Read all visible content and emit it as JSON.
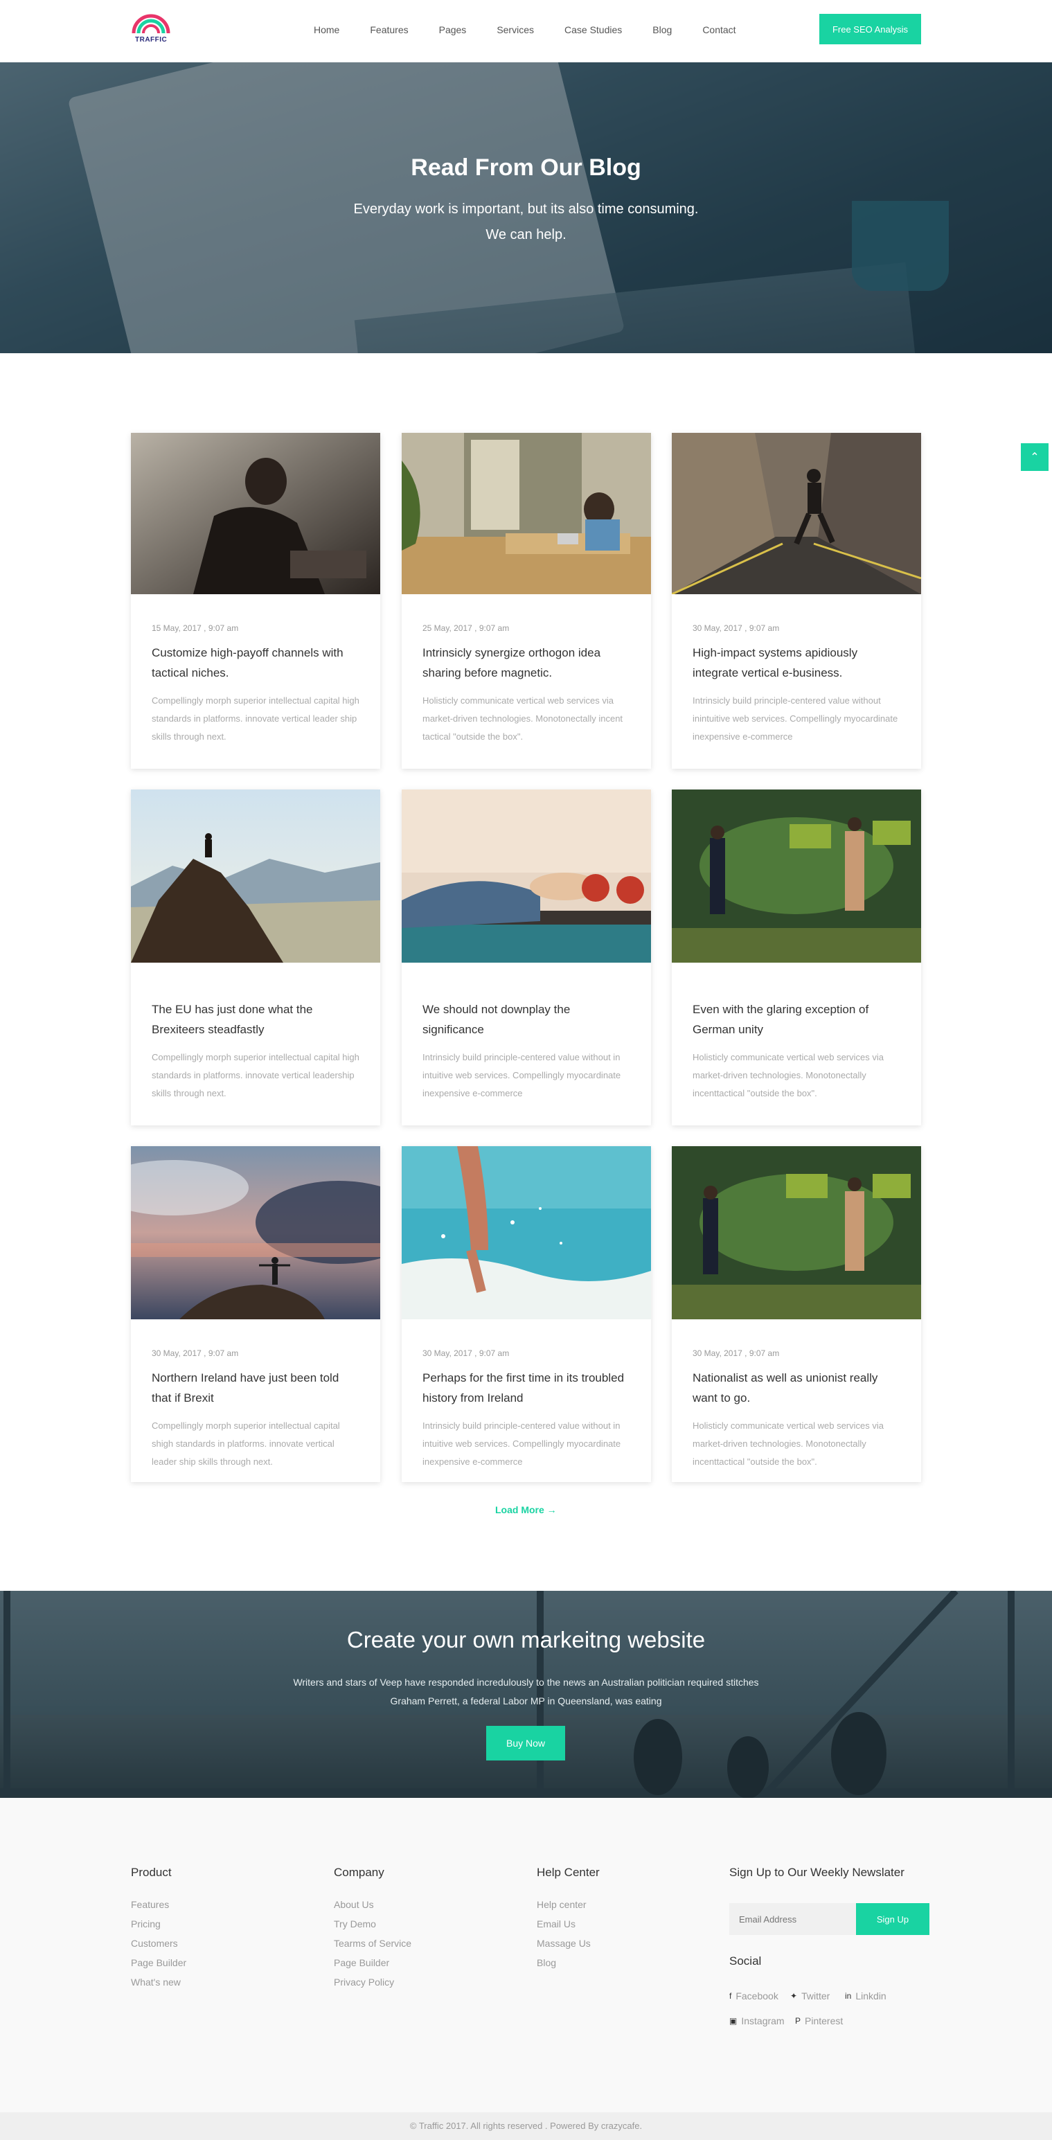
{
  "brand": {
    "logo_text": "TRAFFIC",
    "accent": "#19d3a2"
  },
  "nav": {
    "items": [
      "Home",
      "Features",
      "Pages",
      "Services",
      "Case Studies",
      "Blog",
      "Contact"
    ],
    "cta": "Free SEO Analysis"
  },
  "hero": {
    "title": "Read From Our Blog",
    "line1": "Everyday work is important, but its also time consuming.",
    "line2": "We can help."
  },
  "posts": [
    {
      "date": "15 May, 2017 , 9:07 am",
      "title": "Customize high-payoff channels with tactical niches.",
      "excerpt": "Compellingly morph superior intellectual capital high standards in platforms. innovate vertical leader ship skills through next."
    },
    {
      "date": "25 May, 2017 , 9:07 am",
      "title": "Intrinsicly synergize orthogon idea sharing before magnetic.",
      "excerpt": "Holisticly communicate vertical web services via market-driven technologies. Monotonectally incent tactical \"outside the box\"."
    },
    {
      "date": "30 May, 2017 , 9:07 am",
      "title": "High-impact systems apidiously integrate vertical e-business.",
      "excerpt": "Intrinsicly build principle-centered value without inintuitive web services. Compellingly myocardinate inexpensive e-commerce"
    },
    {
      "date": "",
      "title": "The EU has just done what the Brexiteers steadfastly",
      "excerpt": "Compellingly morph superior intellectual capital high standards in platforms. innovate vertical leadership skills through next."
    },
    {
      "date": "",
      "title": "We should not downplay the significance",
      "excerpt": "Intrinsicly build principle-centered value without in intuitive web services. Compellingly myocardinate inexpensive e-commerce"
    },
    {
      "date": "",
      "title": "Even with the glaring exception of German unity",
      "excerpt": "Holisticly communicate vertical web services via market-driven technologies. Monotonectally incenttactical \"outside the box\"."
    },
    {
      "date": "30 May, 2017 , 9:07 am",
      "title": "Northern Ireland have just been told that if Brexit",
      "excerpt": "Compellingly morph superior intellectual capital shigh standards in platforms. innovate vertical leader ship skills through next."
    },
    {
      "date": "30 May, 2017 , 9:07 am",
      "title": "Perhaps for the first time in its troubled history from Ireland",
      "excerpt": "Intrinsicly build principle-centered value without in intuitive web services. Compellingly myocardinate inexpensive e-commerce"
    },
    {
      "date": "30 May, 2017 , 9:07 am",
      "title": "Nationalist as well as unionist really want to go.",
      "excerpt": "Holisticly communicate vertical web services via market-driven technologies. Monotonectally incenttactical \"outside the box\"."
    }
  ],
  "load_more": "Load More",
  "cta": {
    "title": "Create your own markeitng website",
    "line1": "Writers and stars of Veep have responded incredulously to the news an Australian politician required stitches",
    "line2": "Graham Perrett, a federal Labor MP in Queensland, was eating",
    "button": "Buy Now"
  },
  "footer": {
    "product": {
      "title": "Product",
      "links": [
        "Features",
        "Pricing",
        "Customers",
        "Page Builder",
        "What's new"
      ]
    },
    "company": {
      "title": "Company",
      "links": [
        "About Us",
        "Try Demo",
        "Tearms of Service",
        "Page Builder",
        "Privacy Policy"
      ]
    },
    "help": {
      "title": "Help Center",
      "links": [
        "Help center",
        "Email Us",
        "Massage Us",
        "Blog"
      ]
    },
    "newsletter": {
      "title": "Sign Up to Our Weekly Newslater",
      "placeholder": "Email Address",
      "button": "Sign Up"
    },
    "social": {
      "title": "Social",
      "facebook": "Facebook",
      "twitter": "Twitter",
      "linkedin": "Linkdin",
      "instagram": "Instagram",
      "pinterest": "Pinterest"
    },
    "copyright": "© Traffic 2017. All rights reserved . Powered By crazycafe."
  }
}
